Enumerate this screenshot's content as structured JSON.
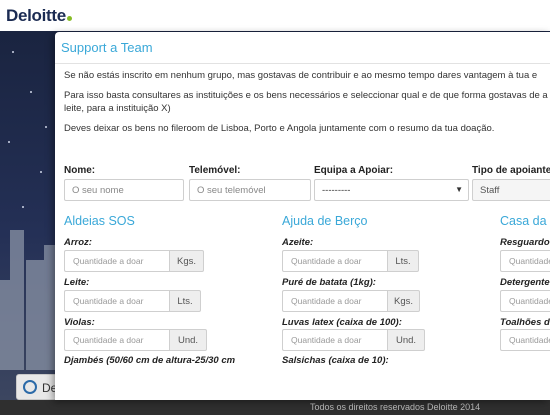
{
  "brand": {
    "logo_text": "Deloitte"
  },
  "background": {
    "pill_text": "De"
  },
  "footer": {
    "text": "Todos os direitos reservados Deloitte 2014"
  },
  "modal": {
    "title": "Support a Team",
    "paragraphs": [
      "Se não estás inscrito em nenhum grupo, mas gostavas de contribuir e ao mesmo tempo dares vantagem à tua e",
      "Para isso basta consultares as instituições e os bens necessários e seleccionar qual e de que forma gostavas de a",
      "leite, para a instituição X)",
      "Deves deixar os bens no fileroom de Lisboa, Porto e Angola juntamente com o resumo da tua doação."
    ],
    "form": {
      "name_label": "Nome:",
      "name_placeholder": "O seu nome",
      "phone_label": "Telemóvel:",
      "phone_placeholder": "O seu telemóvel",
      "team_label": "Equipa a Apoiar:",
      "team_value": "---------",
      "supporter_label": "Tipo de apoiante",
      "supporter_value": "Staff"
    },
    "sections": [
      {
        "title": "Aldeias SOS",
        "items": [
          {
            "label": "Arroz:",
            "placeholder": "Quantidade a doar",
            "unit": "Kgs."
          },
          {
            "label": "Leite:",
            "placeholder": "Quantidade a doar",
            "unit": "Lts."
          },
          {
            "label": "Violas:",
            "placeholder": "Quantidade a doar",
            "unit": "Und."
          },
          {
            "label": "Djambés (50/60 cm de altura-25/30 cm"
          }
        ]
      },
      {
        "title": "Ajuda de Berço",
        "items": [
          {
            "label": "Azeite:",
            "placeholder": "Quantidade a doar",
            "unit": "Lts."
          },
          {
            "label": "Puré de batata (1kg):",
            "placeholder": "Quantidade a doar",
            "unit": "Kgs."
          },
          {
            "label": "Luvas latex (caixa de 100):",
            "placeholder": "Quantidade a doar",
            "unit": "Und."
          },
          {
            "label": "Salsichas (caixa de 10):"
          }
        ]
      },
      {
        "title": "Casa da B",
        "items": [
          {
            "label": "Resguardo",
            "placeholder": "Quantidade"
          },
          {
            "label": "Detergente",
            "placeholder": "Quantidade"
          },
          {
            "label": "Toalhões d",
            "placeholder": "Quantidade"
          }
        ]
      }
    ]
  }
}
